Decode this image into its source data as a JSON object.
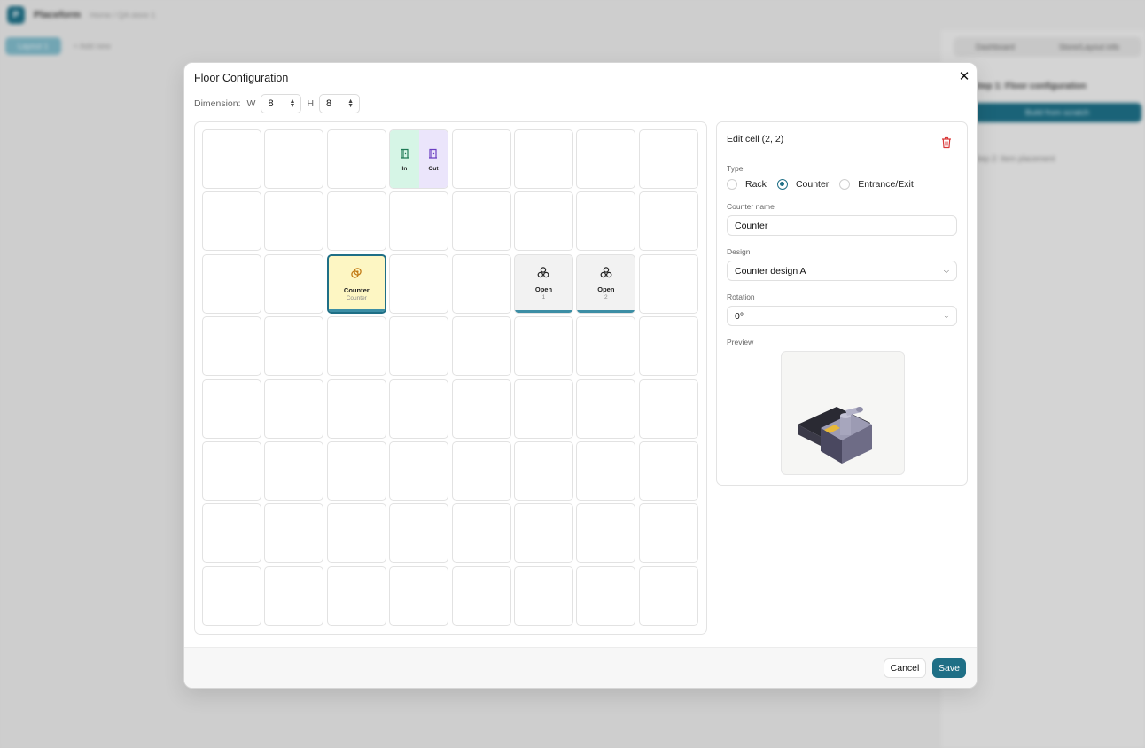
{
  "background": {
    "app_name": "Placeform",
    "breadcrumb": "Home  /  QA store 1",
    "active_tab": "Layout 1",
    "add_link": "+  Add new",
    "seg_tabs": [
      "Dashboard",
      "Store/Layout info"
    ],
    "step1": "Step 1: Floor configuration",
    "step1_button": "Build from scratch",
    "step2": "Step 2: Item placement"
  },
  "modal": {
    "title": "Floor Configuration",
    "close_icon": "close-icon",
    "dimension_label": "Dimension:",
    "width_label": "W",
    "width_value": "8",
    "height_label": "H",
    "height_value": "8"
  },
  "grid": {
    "cols": 8,
    "rows": 8,
    "special_cells": [
      {
        "row": 0,
        "col": 3,
        "type": "entrance",
        "in_label": "In",
        "out_label": "Out"
      },
      {
        "row": 2,
        "col": 2,
        "type": "counter",
        "name": "Counter",
        "sub": "Counter",
        "selected": true
      },
      {
        "row": 2,
        "col": 5,
        "type": "rack",
        "name": "Open",
        "sub": "1"
      },
      {
        "row": 2,
        "col": 6,
        "type": "rack",
        "name": "Open",
        "sub": "2"
      }
    ]
  },
  "edit": {
    "title": "Edit cell (2, 2)",
    "type_label": "Type",
    "type_options": [
      "Rack",
      "Counter",
      "Entrance/Exit"
    ],
    "type_selected": "Counter",
    "counter_name_label": "Counter name",
    "counter_name_value": "Counter",
    "design_label": "Design",
    "design_value": "Counter design A",
    "rotation_label": "Rotation",
    "rotation_value": "0°",
    "preview_label": "Preview"
  },
  "footer": {
    "cancel_label": "Cancel",
    "save_label": "Save"
  },
  "colors": {
    "accent": "#1f6f86",
    "counter_fill": "#fdf6c3",
    "entrance_in": "#d6f5e6",
    "entrance_out": "#ebe5fb",
    "delete_red": "#d93a3a"
  }
}
